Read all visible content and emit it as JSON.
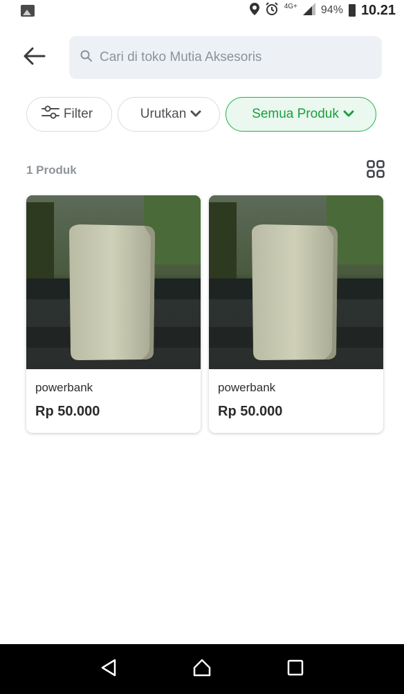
{
  "status_bar": {
    "network": "4G+",
    "battery": "94%",
    "time": "10.21"
  },
  "search": {
    "placeholder": "Cari di toko Mutia Aksesoris"
  },
  "chips": {
    "filter": "Filter",
    "sort": "Urutkan",
    "category": "Semua Produk"
  },
  "results": {
    "count_label": "1 Produk"
  },
  "products": [
    {
      "name": "powerbank",
      "price": "Rp 50.000"
    },
    {
      "name": "powerbank",
      "price": "Rp 50.000"
    }
  ],
  "colors": {
    "accent_green": "#20b04b",
    "search_bg": "#edf1f6",
    "nav_bg": "#000000"
  },
  "icons": [
    "gallery-icon",
    "location-icon",
    "alarm-icon",
    "signal-icon",
    "battery-icon",
    "back-arrow-icon",
    "search-icon",
    "filter-icon",
    "chevron-down-icon",
    "grid-view-icon",
    "nav-back-icon",
    "nav-home-icon",
    "nav-recents-icon"
  ]
}
